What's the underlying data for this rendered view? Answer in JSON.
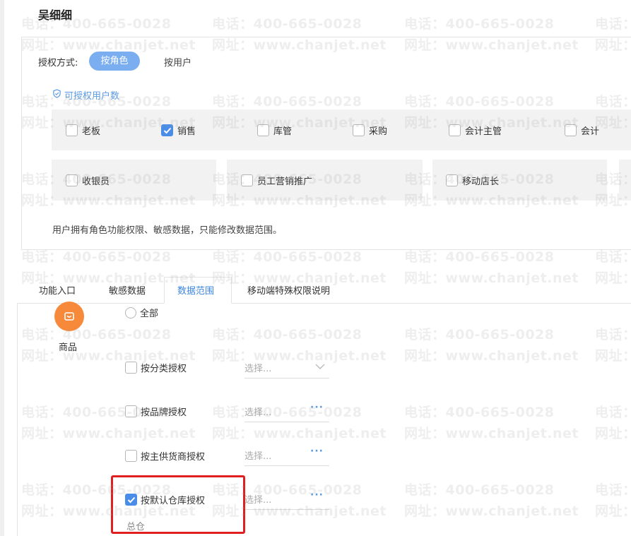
{
  "page_title": "吴细细",
  "auth": {
    "label": "授权方式:",
    "by_role": "按角色",
    "by_user": "按用户",
    "user_count_label": "可授权用户数"
  },
  "roles": [
    {
      "label": "老板",
      "checked": false
    },
    {
      "label": "销售",
      "checked": true
    },
    {
      "label": "库管",
      "checked": false
    },
    {
      "label": "采购",
      "checked": false
    },
    {
      "label": "会计主管",
      "checked": false
    },
    {
      "label": "会计",
      "checked": false
    },
    {
      "label": "收银员",
      "checked": false
    },
    {
      "label": "员工营销推广",
      "checked": false
    },
    {
      "label": "移动店长",
      "checked": false
    }
  ],
  "note": "用户拥有角色功能权限、敏感数据，只能修改数据范围。",
  "tabs": [
    {
      "label": "功能入口",
      "active": false
    },
    {
      "label": "敏感数据",
      "active": false
    },
    {
      "label": "数据范围",
      "active": true
    },
    {
      "label": "移动端特殊权限说明",
      "active": false
    }
  ],
  "goods": {
    "label": "商品"
  },
  "scope": {
    "all_label": "全部",
    "options": [
      {
        "label": "按分类授权",
        "checked": false,
        "placeholder": "选择...",
        "control": "chevron"
      },
      {
        "label": "按品牌授权",
        "checked": false,
        "placeholder": "选择...",
        "control": "dots"
      },
      {
        "label": "按主供货商授权",
        "checked": false,
        "placeholder": "选择...",
        "control": "dots"
      },
      {
        "label": "按默认仓库授权",
        "checked": true,
        "placeholder": "选择...",
        "control": "dots"
      }
    ],
    "default_warehouse_value": "总仓"
  },
  "watermark": {
    "phone": "电话：400-665-0028",
    "site": "网址：www.chanjet.net"
  },
  "colors": {
    "accent": "#4a8de8",
    "pill": "#7aaef0",
    "goods_icon": "#f7893b",
    "highlight": "#e02020"
  }
}
